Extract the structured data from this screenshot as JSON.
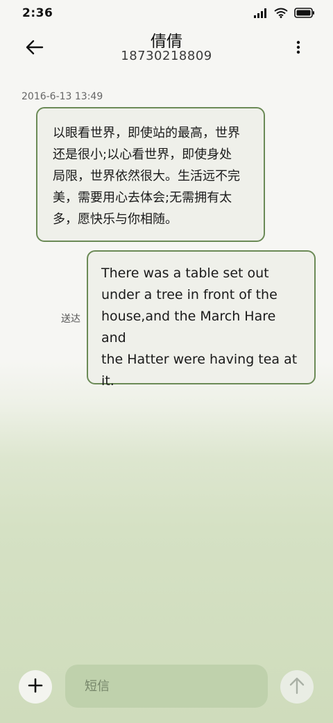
{
  "status_bar": {
    "time": "2:36",
    "icons": [
      "signal-icon",
      "wifi-icon",
      "battery-icon"
    ]
  },
  "header": {
    "contact_name": "倩倩",
    "phone_number": "18730218809",
    "icons": {
      "back": "back-arrow-icon",
      "more": "more-vertical-icon"
    }
  },
  "conversation": {
    "timestamp": "2016-6-13 13:49",
    "messages": [
      {
        "direction": "incoming",
        "lines": [
          "以眼看世界，即使站的最高，世界",
          "还是很小;以心看世界，即使身处",
          "局限，世界依然很大。生活远不完",
          "美，需要用心去体会;无需拥有太",
          "多，愿快乐与你相随。"
        ]
      },
      {
        "direction": "outgoing",
        "status": "送达",
        "lines": [
          "There was a table set out",
          "under a tree in front of the",
          "house,and the March Hare and",
          "the Hatter were having tea at",
          "it."
        ]
      }
    ]
  },
  "composer": {
    "placeholder": "短信",
    "value": "",
    "icons": {
      "add": "plus-icon",
      "send": "send-arrow-icon"
    }
  },
  "colors": {
    "bubble_border": "#6b8a56",
    "bubble_fill": "#eff0ea",
    "input_fill": "#bfd1ac"
  }
}
